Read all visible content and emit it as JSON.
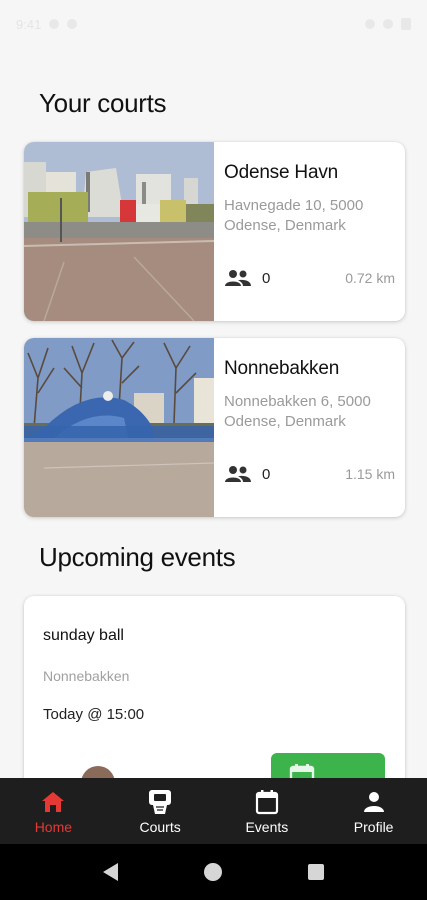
{
  "status_bar": {
    "time": "9:41"
  },
  "sections": {
    "courts_title": "Your courts",
    "events_title": "Upcoming events"
  },
  "courts": [
    {
      "name": "Odense Havn",
      "address": "Havnegade 10, 5000 Odense, Denmark",
      "players": "0",
      "distance": "0.72 km",
      "photo": "court-photo-harbour"
    },
    {
      "name": "Nonnebakken",
      "address": "Nonnebakken 6, 5000 Odense, Denmark",
      "players": "0",
      "distance": "1.15 km",
      "photo": "court-photo-park"
    }
  ],
  "events": [
    {
      "title": "sunday ball",
      "location": "Nonnebakken",
      "time": "Today @ 15:00",
      "join_icon": "calendar-add-icon"
    }
  ],
  "bottom_nav": {
    "items": [
      {
        "label": "Home",
        "icon": "home-icon",
        "active": true
      },
      {
        "label": "Courts",
        "icon": "basketball-hoop-icon",
        "active": false
      },
      {
        "label": "Events",
        "icon": "calendar-icon",
        "active": false
      },
      {
        "label": "Profile",
        "icon": "person-icon",
        "active": false
      }
    ]
  },
  "colors": {
    "accent_active": "#e53935",
    "join_green": "#3cb44b",
    "nav_background": "#1e1e1e"
  }
}
